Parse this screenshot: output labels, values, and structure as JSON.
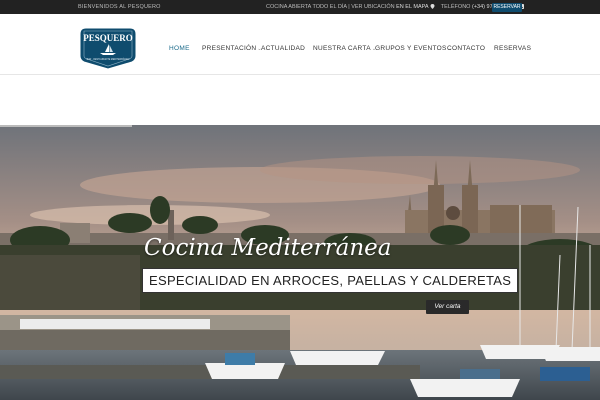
{
  "topbar": {
    "welcome": "BIENVENIDOS AL PESQUERO",
    "open_text": "COCINA ABIERTA TODO EL DÍA",
    "separator": "|",
    "location_text": "VER UBICACIÓN",
    "map_link": "EN EL MAPA",
    "phone_label": "TELÉFONO",
    "phone": "(+34) 971 715 220",
    "reservar": "RESERVAR"
  },
  "logo": {
    "name": "PESQUERO",
    "tagline": "BAR · RESTAURANTE MEDITERRÁNEO"
  },
  "nav": {
    "items": [
      {
        "label": "HOME",
        "active": true
      },
      {
        "label": "PRESENTACIÓN",
        "dropdown": true
      },
      {
        "label": "ACTUALIDAD"
      },
      {
        "label": "NUESTRA CARTA",
        "dropdown": true
      },
      {
        "label": "GRUPOS Y EVENTOS",
        "dropdown": true
      },
      {
        "label": "CONTACTO"
      },
      {
        "label": "RESERVAS"
      }
    ]
  },
  "hero": {
    "title": "Cocina Mediterránea",
    "subtitle": "ESPECIALIDAD EN ARROCES, PAELLAS Y CALDERETAS",
    "cta": "Ver carta",
    "slide_progress": 0.22
  },
  "colors": {
    "brand": "#0f4c6e",
    "active_nav": "#1a6a8a",
    "topbar_bg": "#222222"
  }
}
